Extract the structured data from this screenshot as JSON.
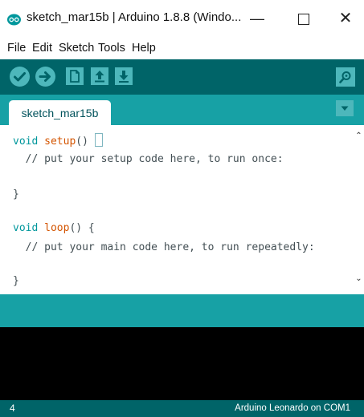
{
  "window": {
    "title": "sketch_mar15b | Arduino 1.8.8 (Windo...",
    "app_icon": "arduino-logo-icon",
    "controls": {
      "minimize": "—",
      "close": "✕"
    }
  },
  "menubar": {
    "items": [
      "File",
      "Edit",
      "Sketch",
      "Tools",
      "Help"
    ]
  },
  "toolbar": {
    "buttons": [
      "verify-icon",
      "upload-icon",
      "new-icon",
      "open-icon",
      "save-icon",
      "serial-monitor-icon"
    ]
  },
  "tabs": {
    "items": [
      {
        "label": "sketch_mar15b"
      }
    ],
    "menu_icon": "tab-menu-icon"
  },
  "editor": {
    "lines": [
      "void setup() {",
      "  // put your setup code here, to run once:",
      "",
      "}",
      "",
      "void loop() {",
      "  // put your main code here, to run repeatedly:",
      "",
      "}"
    ],
    "comment_setup": "  // put your setup code here, to run once:",
    "comment_loop": "  // put your main code here, to run repeatedly:",
    "close_brace": "}"
  },
  "footer": {
    "line_number": "4",
    "board": "Arduino Leonardo on COM1"
  },
  "colors": {
    "toolbar_bg": "#006468",
    "tabbar_bg": "#17a1a5",
    "button_fill": "#4db7bb",
    "console_bg": "#000000",
    "keyword": "#00979c",
    "function": "#d35400"
  }
}
